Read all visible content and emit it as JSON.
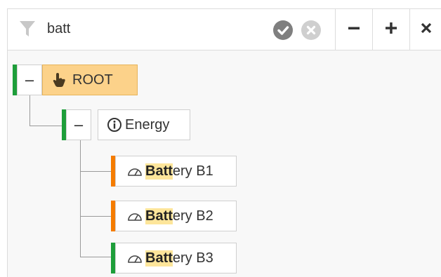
{
  "colors": {
    "status_green": "#1e9e3a",
    "status_orange": "#f57c00",
    "root_fill": "#fcd28a",
    "highlight": "#fde59a"
  },
  "toolbar": {
    "filter_icon": "filter-icon",
    "search_value": "batt",
    "apply_icon": "check-circle-icon",
    "clear_icon": "x-circle-icon",
    "collapse_all_label": "−",
    "expand_all_label": "+",
    "close_label": "×"
  },
  "tree": {
    "root": {
      "toggle_label": "–",
      "icon": "hand-pointer-icon",
      "label": "ROOT",
      "status": "green"
    },
    "energy": {
      "toggle_label": "–",
      "icon": "info-circle-icon",
      "label": "Energy",
      "status": "green"
    },
    "leaves": [
      {
        "icon": "gauge-icon",
        "match": "Batt",
        "rest": "ery B1",
        "status": "orange"
      },
      {
        "icon": "gauge-icon",
        "match": "Batt",
        "rest": "ery B2",
        "status": "orange"
      },
      {
        "icon": "gauge-icon",
        "match": "Batt",
        "rest": "ery B3",
        "status": "green"
      }
    ]
  }
}
